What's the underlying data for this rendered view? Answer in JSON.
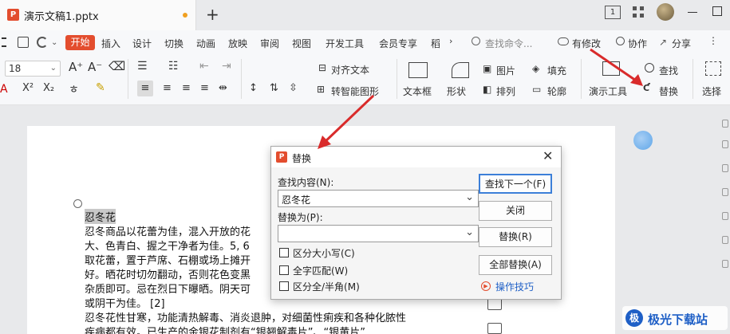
{
  "tab": {
    "title": "演示文稿1.pptx",
    "logo": "P"
  },
  "window": {
    "new_tab": "+",
    "page_indicator": "1"
  },
  "menu": {
    "items": [
      "开始",
      "插入",
      "设计",
      "切换",
      "动画",
      "放映",
      "审阅",
      "视图",
      "开发工具",
      "会员专享",
      "稻"
    ],
    "search_placeholder": "查找命令...",
    "unsaved": "有修改",
    "collaborate": "协作",
    "share": "分享"
  },
  "toolbar": {
    "font_size": "18",
    "align_text": "对齐文本",
    "smart_shape": "转智能图形",
    "text_box": "文本框",
    "shape": "形状",
    "picture": "图片",
    "arrange": "排列",
    "fill": "填充",
    "outline": "轮廓",
    "present_tools": "演示工具",
    "find": "查找",
    "replace": "替换",
    "select": "选择"
  },
  "slide": {
    "lines": [
      "忍冬花",
      "忍冬商品以花蕾为佳，混入开放的花",
      "大、色青白、握之干净者为佳。5, 6",
      "取花蕾，置于芦席、石棚或场上摊开",
      "好。晒花时切勿翻动，否则花色变黑",
      "杂质即可。忌在烈日下曝晒。阴天可",
      "或阴干为佳。 [2]",
      "忍冬花性甘寒，功能清热解毒、消炎退肿，对细菌性痢疾和各种化脓性",
      "疾病都有效。已生产的金银花制剂有“银翘解毒片”、“银黄片”"
    ]
  },
  "dialog": {
    "title": "替换",
    "find_label": "查找内容(N):",
    "find_value": "忍冬花",
    "replace_label": "替换为(P):",
    "replace_value": "",
    "options": [
      "区分大小写(C)",
      "全字匹配(W)",
      "区分全/半角(M)"
    ],
    "buttons": {
      "find_next": "查找下一个(F)",
      "close": "关闭",
      "replace": "替换(R)",
      "replace_all": "全部替换(A)"
    },
    "tips": "操作技巧"
  },
  "watermark": "极光下载站",
  "colors": {
    "brand": "#e34d2e",
    "arrow": "#d92b2b",
    "accent_blue": "#1e5fc6"
  }
}
